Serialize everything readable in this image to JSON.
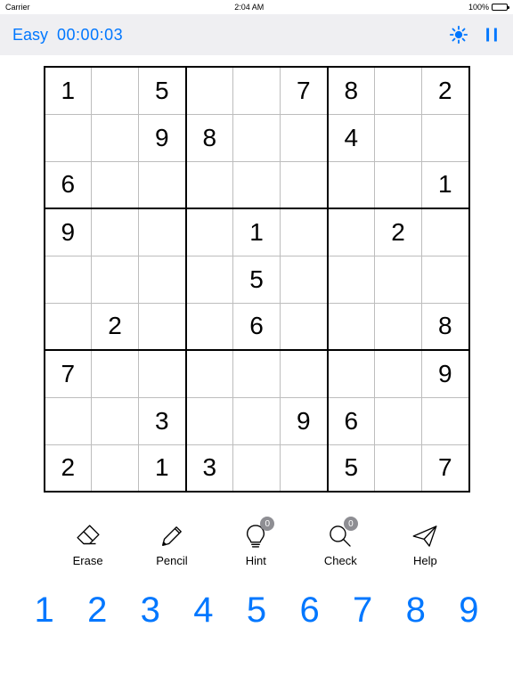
{
  "statusbar": {
    "carrier": "Carrier",
    "time": "2:04 AM",
    "battery": "100%"
  },
  "topbar": {
    "difficulty": "Easy",
    "timer": "00:00:03"
  },
  "board": [
    [
      "1",
      "",
      "5",
      "",
      "",
      "7",
      "8",
      "",
      "2"
    ],
    [
      "",
      "",
      "9",
      "8",
      "",
      "",
      "4",
      "",
      ""
    ],
    [
      "6",
      "",
      "",
      "",
      "",
      "",
      "",
      "",
      "1"
    ],
    [
      "9",
      "",
      "",
      "",
      "1",
      "",
      "",
      "2",
      ""
    ],
    [
      "",
      "",
      "",
      "",
      "5",
      "",
      "",
      "",
      ""
    ],
    [
      "",
      "2",
      "",
      "",
      "6",
      "",
      "",
      "",
      "8"
    ],
    [
      "7",
      "",
      "",
      "",
      "",
      "",
      "",
      "",
      "9"
    ],
    [
      "",
      "",
      "3",
      "",
      "",
      "9",
      "6",
      "",
      ""
    ],
    [
      "2",
      "",
      "1",
      "3",
      "",
      "",
      "5",
      "",
      "7"
    ]
  ],
  "tools": {
    "erase": "Erase",
    "pencil": "Pencil",
    "hint": "Hint",
    "hint_badge": "0",
    "check": "Check",
    "check_badge": "0",
    "help": "Help"
  },
  "numpad": [
    "1",
    "2",
    "3",
    "4",
    "5",
    "6",
    "7",
    "8",
    "9"
  ]
}
